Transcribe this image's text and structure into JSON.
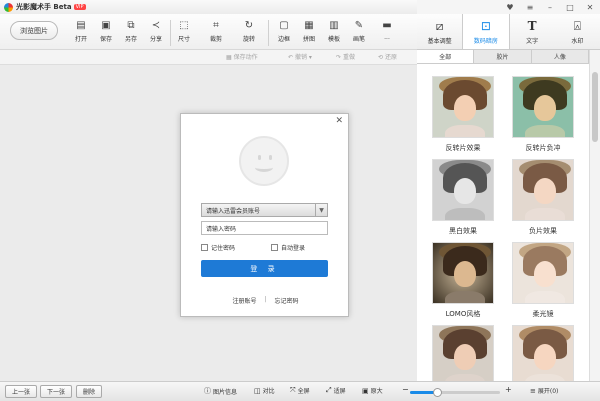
{
  "app": {
    "title": "光影魔术手 Beta",
    "badge": "VIP"
  },
  "toolbar": {
    "browse_label": "浏览图片",
    "tools": [
      {
        "label": "打开",
        "icon": "open-icon"
      },
      {
        "label": "保存",
        "icon": "save-icon"
      },
      {
        "label": "另存",
        "icon": "save-as-icon"
      },
      {
        "label": "分享",
        "icon": "share-icon"
      },
      {
        "label": "尺寸",
        "icon": "resize-icon"
      },
      {
        "label": "裁剪",
        "icon": "crop-icon"
      },
      {
        "label": "旋转",
        "icon": "rotate-icon"
      },
      {
        "label": "边框",
        "icon": "border-icon"
      },
      {
        "label": "拼图",
        "icon": "collage-icon"
      },
      {
        "label": "模板",
        "icon": "template-icon"
      },
      {
        "label": "画笔",
        "icon": "brush-icon"
      },
      {
        "label": "...",
        "icon": "more-icon"
      }
    ]
  },
  "subbar": {
    "save_action": "保存动作",
    "undo": "撤销",
    "redo": "重做",
    "restore": "还原"
  },
  "right_tabs": [
    {
      "label": "基本调整",
      "icon": "adjust-icon"
    },
    {
      "label": "数码暗房",
      "icon": "darkroom-icon"
    },
    {
      "label": "文字",
      "icon": "text-icon"
    },
    {
      "label": "水印",
      "icon": "watermark-icon"
    }
  ],
  "filter_tabs": [
    "全部",
    "胶片",
    "人像"
  ],
  "effects": [
    {
      "label": "反转片效果"
    },
    {
      "label": "反转片负冲"
    },
    {
      "label": "黑白效果"
    },
    {
      "label": "负片效果"
    },
    {
      "label": "LOMO风格"
    },
    {
      "label": "柔光镜"
    },
    {
      "label": ""
    },
    {
      "label": ""
    }
  ],
  "login": {
    "account_placeholder": "请输入迅雷会员账号",
    "password_placeholder": "请输入密码",
    "remember": "记住密码",
    "auto_login": "自动登录",
    "login_button": "登 录",
    "register": "注册账号",
    "separator": "|",
    "forgot": "忘记密码"
  },
  "bottom": {
    "prev": "上一张",
    "next": "下一张",
    "delete": "删除",
    "info": "图片信息",
    "compare": "对比",
    "fullscreen": "全屏",
    "fit": "适屏",
    "original": "原大",
    "zoom_level": 0.3,
    "expand": "展开(0)"
  }
}
